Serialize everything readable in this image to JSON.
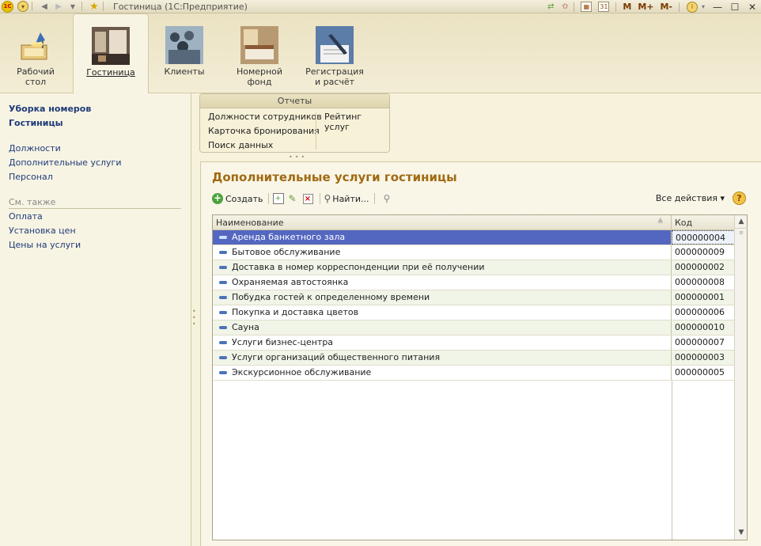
{
  "titlebar": {
    "logo_text": "1С",
    "title": "Гостиница  (1С:Предприятие)",
    "mem_buttons": [
      "M",
      "M+",
      "M-"
    ],
    "calendar_day": "31"
  },
  "sections": [
    {
      "label": "Рабочий\nстол",
      "icon": "desk-lamp-icon"
    },
    {
      "label": "Гостиница",
      "icon": "hotel-icon",
      "active": true
    },
    {
      "label": "Клиенты",
      "icon": "clients-icon"
    },
    {
      "label": "Номерной\nфонд",
      "icon": "room-icon"
    },
    {
      "label": "Регистрация\nи расчёт",
      "icon": "registration-icon"
    }
  ],
  "leftnav": {
    "bold_items": [
      "Уборка номеров",
      "Гостиницы"
    ],
    "items": [
      "Должности",
      "Дополнительные услуги",
      "Персонал"
    ],
    "see_also": "См. также",
    "see_also_items": [
      "Оплата",
      "Установка цен",
      "Цены на услуги"
    ]
  },
  "reports": {
    "header": "Отчеты",
    "col1": [
      "Должности сотрудников",
      "Карточка бронирования",
      "Поиск данных"
    ],
    "col2": [
      "Рейтинг услуг"
    ]
  },
  "form": {
    "title": "Дополнительные услуги гостиницы",
    "toolbar": {
      "create_label": "Создать",
      "find_label": "Найти...",
      "all_actions_label": "Все действия ▾"
    },
    "table": {
      "columns": [
        "Наименование",
        "Код"
      ],
      "rows": [
        {
          "name": "Аренда банкетного зала",
          "code": "000000004"
        },
        {
          "name": "Бытовое обслуживание",
          "code": "000000009"
        },
        {
          "name": "Доставка в номер корреспонденции при её получении",
          "code": "000000002"
        },
        {
          "name": "Охраняемая автостоянка",
          "code": "000000008"
        },
        {
          "name": "Побудка гостей к определенному времени",
          "code": "000000001"
        },
        {
          "name": "Покупка и доставка цветов",
          "code": "000000006"
        },
        {
          "name": "Сауна",
          "code": "000000010"
        },
        {
          "name": "Услуги бизнес-центра",
          "code": "000000007"
        },
        {
          "name": "Услуги организаций общественного питания",
          "code": "000000003"
        },
        {
          "name": "Экскурсионное обслуживание",
          "code": "000000005"
        }
      ]
    }
  }
}
